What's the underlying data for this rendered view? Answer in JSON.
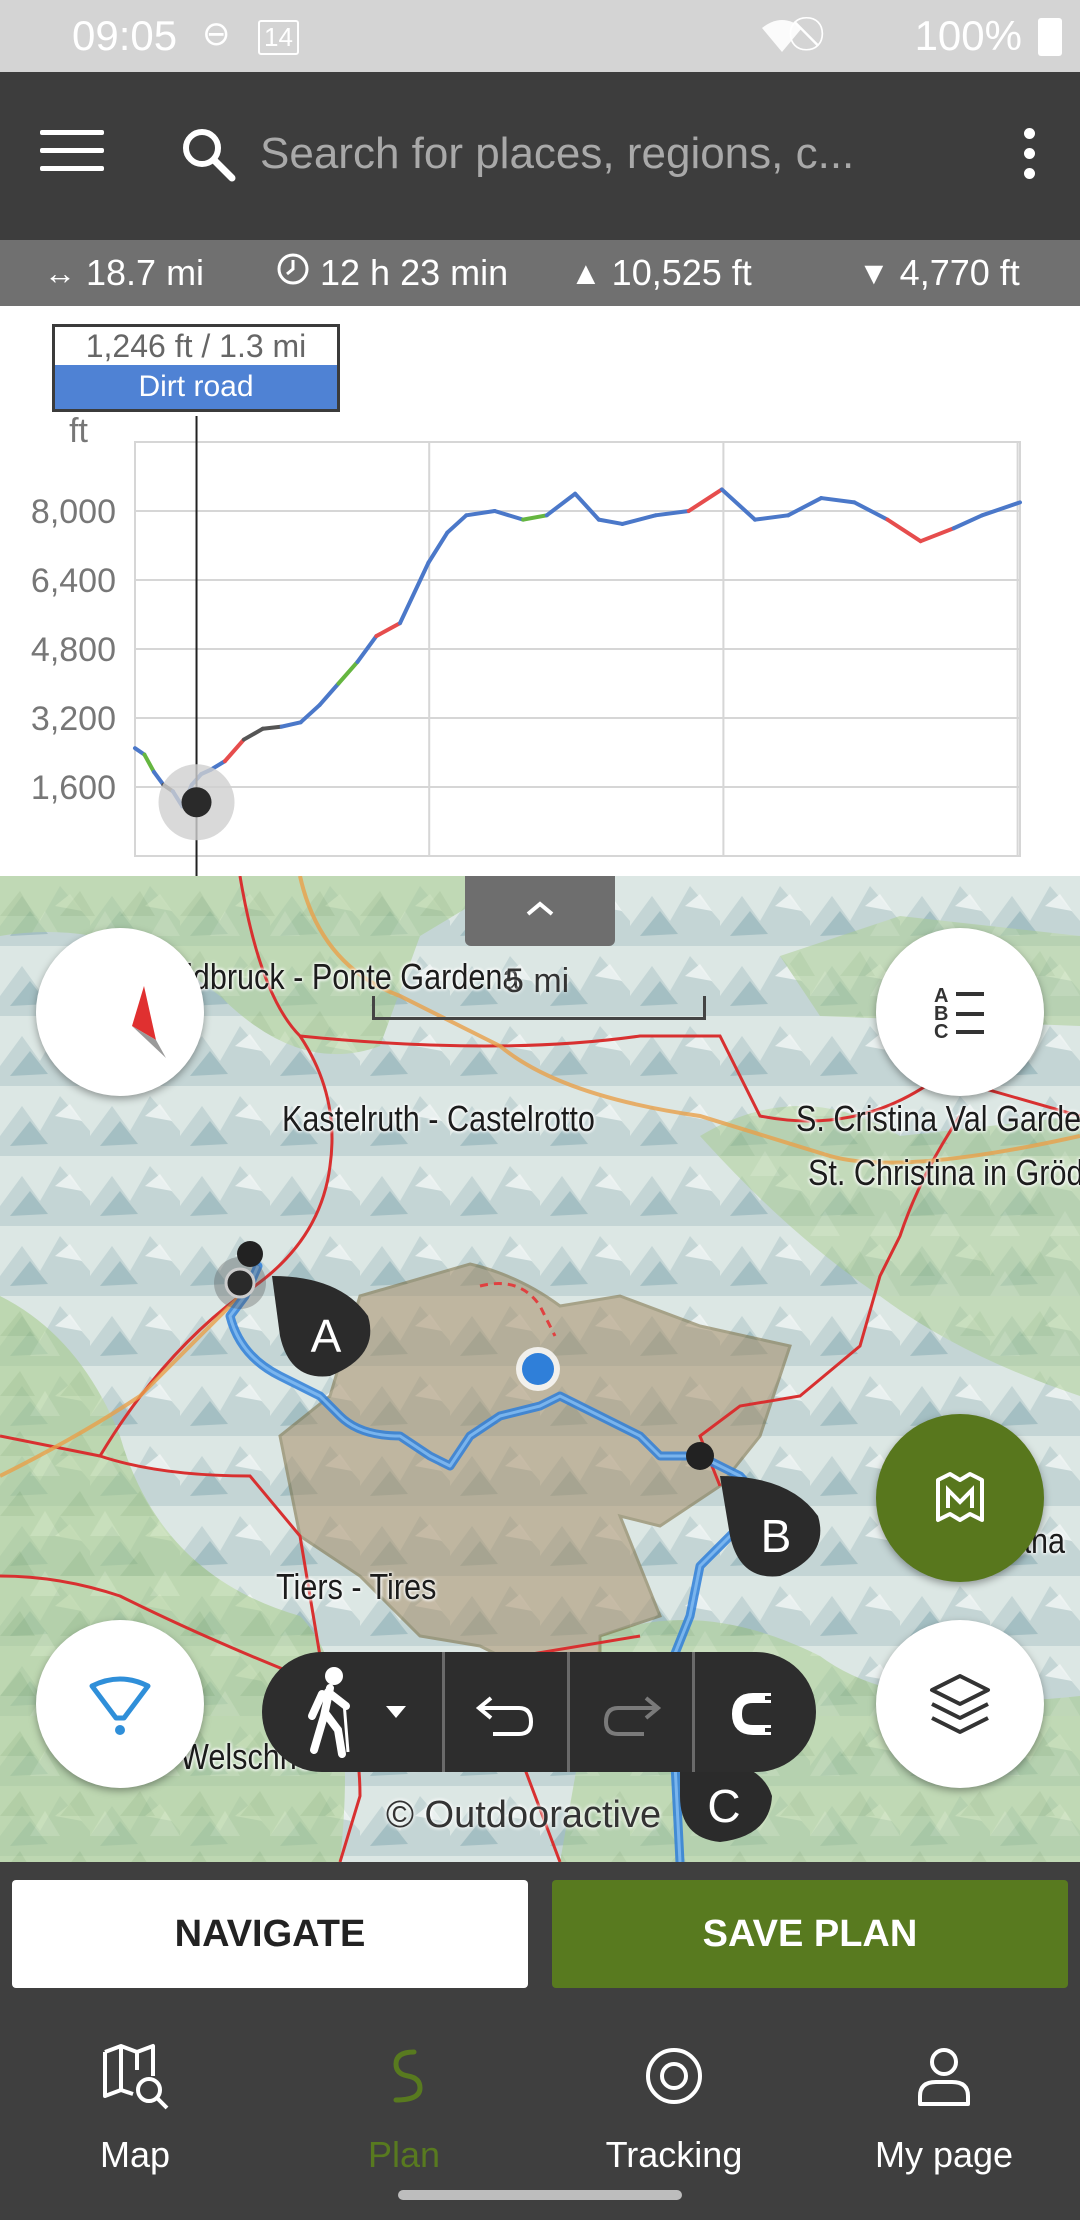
{
  "status_bar": {
    "time": "09:05",
    "battery": "100%",
    "calendar_day": "14"
  },
  "search": {
    "placeholder": "Search for places, regions, c..."
  },
  "stats": {
    "distance": "18.7 mi",
    "duration": "12 h 23 min",
    "ascent": "10,525 ft",
    "descent": "4,770 ft"
  },
  "chart_data": {
    "type": "line",
    "title": "",
    "xlabel": "",
    "ylabel": "ft",
    "y_ticks": [
      "8,000",
      "6,400",
      "4,800",
      "3,200",
      "1,600"
    ],
    "x": [
      0.0,
      0.2,
      0.4,
      0.6,
      0.8,
      1.0,
      1.2,
      1.4,
      1.6,
      1.9,
      2.3,
      2.7,
      3.1,
      3.5,
      3.9,
      4.3,
      4.7,
      5.1,
      5.6,
      6.2,
      6.6,
      7.0,
      7.6,
      8.2,
      8.7,
      9.3,
      9.8,
      10.3,
      11.0,
      11.7,
      12.4,
      13.1,
      13.8,
      14.5,
      15.2,
      15.9,
      16.6,
      17.3,
      17.9,
      18.7
    ],
    "y": [
      2500,
      2350,
      1950,
      1650,
      1500,
      1150,
      1650,
      1900,
      2000,
      2200,
      2700,
      2950,
      3000,
      3100,
      3500,
      4000,
      4500,
      5100,
      5400,
      6800,
      7500,
      7900,
      8000,
      7800,
      7900,
      8400,
      7800,
      7700,
      7900,
      8000,
      8500,
      7800,
      7900,
      8300,
      8200,
      7800,
      7300,
      7600,
      7900,
      8200
    ],
    "ylim": [
      0,
      9600
    ],
    "grid": true,
    "legend": "none",
    "segment_colors": {
      "road": "#4b78c9",
      "path": "#65b640",
      "trail": "#e64d4d",
      "unknown": "#555555"
    },
    "cursor": {
      "x": 1.3,
      "y": 1246
    },
    "tooltip": {
      "value_label": "1,246 ft / 1.3 mi",
      "surface": "Dirt road"
    }
  },
  "map": {
    "labels": {
      "ponte_gardena": "idbruck - Ponte Gardena",
      "kastelruth": "Kastelruth - Castelrotto",
      "scristina": "S. Cristina Val Garde",
      "stchristina": "St. Christina in Gröd",
      "tiers": "Tiers - Tires",
      "welschnofen": "Welschnofen - Nova Levante",
      "nova_right": "ana"
    },
    "scale": "5 mi",
    "waypoints": [
      "A",
      "B",
      "C"
    ],
    "copyright": "© Outdooractive"
  },
  "actions": {
    "navigate": "NAVIGATE",
    "save_plan": "SAVE PLAN"
  },
  "nav": {
    "items": [
      {
        "label": "Map"
      },
      {
        "label": "Plan"
      },
      {
        "label": "Tracking"
      },
      {
        "label": "My page"
      }
    ],
    "active": "Plan",
    "active_color": "#587a1f"
  }
}
